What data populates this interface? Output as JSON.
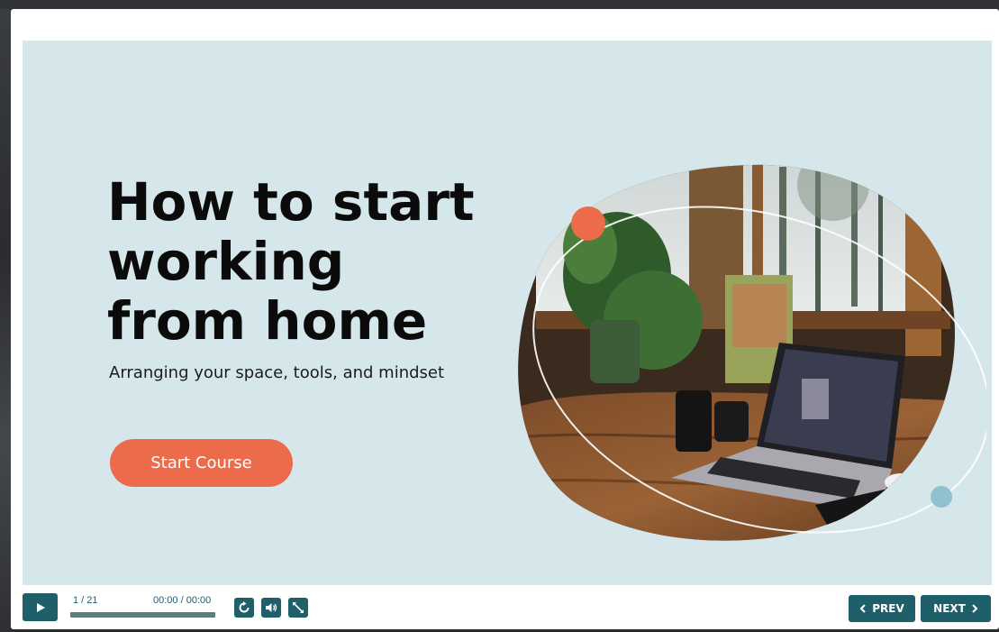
{
  "slide": {
    "headline_line1": "How to start",
    "headline_line2": "working",
    "headline_line3": "from home",
    "subtitle": "Arranging your space, tools, and mindset",
    "cta_label": "Start Course"
  },
  "controls": {
    "slide_counter": "1 / 21",
    "time_display": "00:00 / 00:00",
    "progress": 0,
    "prev_label": "PREV",
    "next_label": "NEXT"
  },
  "icons": [
    "play-icon",
    "replay-icon",
    "volume-icon",
    "fullscreen-icon",
    "chevron-left-icon",
    "chevron-right-icon"
  ],
  "colors": {
    "slide_background": "#d6e7eb",
    "accent_orange": "#ec6b4b",
    "control_teal": "#1e5f6a",
    "dot_blue": "#8fc1cf"
  }
}
